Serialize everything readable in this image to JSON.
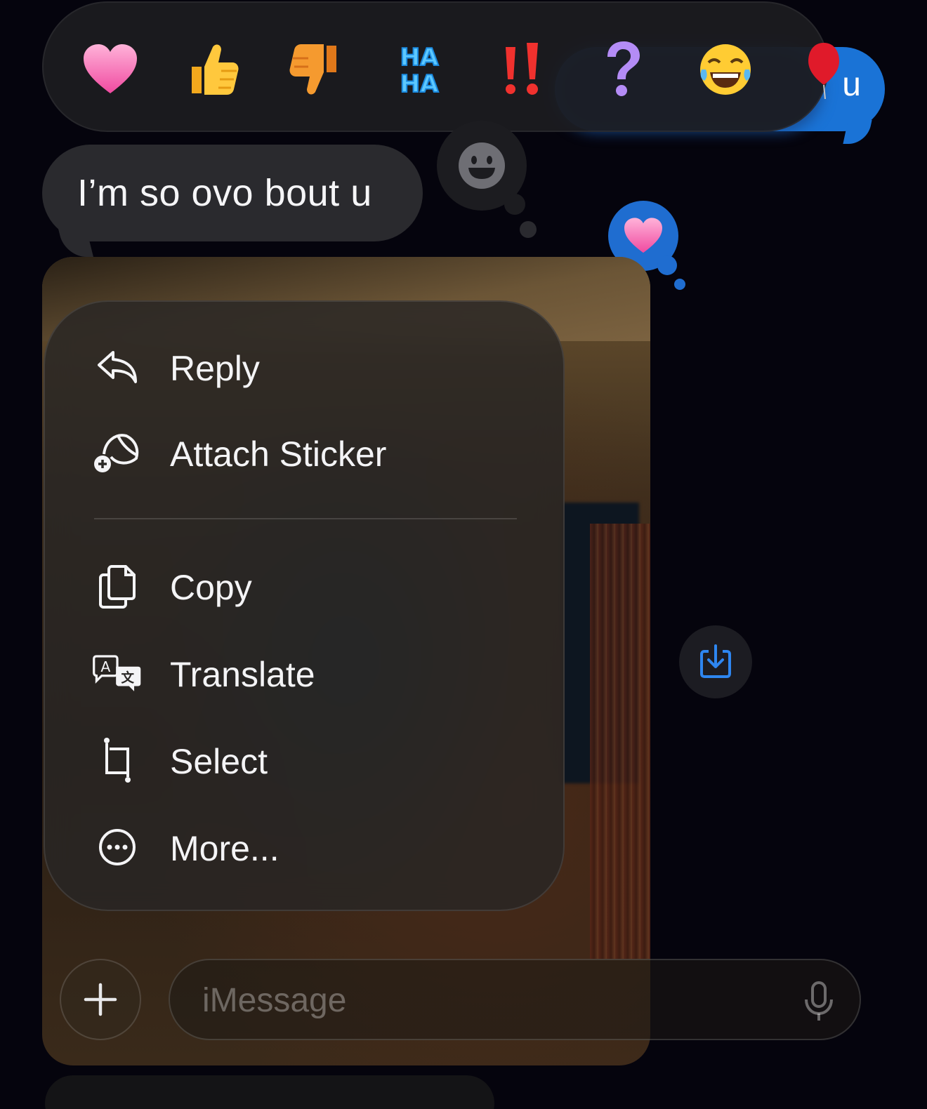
{
  "conversation": {
    "outgoing_bubble": {
      "visible_text": "u"
    },
    "incoming_bubble": {
      "text": "I’m so ovo bout u"
    }
  },
  "tapbacks": [
    {
      "icon": "heart-icon"
    },
    {
      "icon": "thumbs-up-icon"
    },
    {
      "icon": "thumbs-down-icon"
    },
    {
      "icon": "haha-icon",
      "text": "HA HA"
    },
    {
      "icon": "double-exclamation-icon",
      "text": "!!"
    },
    {
      "icon": "question-mark-icon",
      "text": "?"
    },
    {
      "icon": "laughing-emoji-icon"
    },
    {
      "icon": "red-balloon-icon"
    }
  ],
  "context_menu": {
    "items": [
      {
        "icon": "reply-icon",
        "label": "Reply"
      },
      {
        "icon": "sticker-add-icon",
        "label": "Attach Sticker"
      },
      {
        "icon": "copy-icon",
        "label": "Copy"
      },
      {
        "icon": "translate-icon",
        "label": "Translate"
      },
      {
        "icon": "select-crop-icon",
        "label": "Select"
      },
      {
        "icon": "more-ellipsis-icon",
        "label": "More..."
      }
    ]
  },
  "compose": {
    "placeholder": "iMessage",
    "add_icon": "plus-icon",
    "mic_icon": "microphone-icon"
  },
  "colors": {
    "accent_blue": "#1a73d6",
    "background": "#05040d",
    "bubble_gray": "#2a2a2e"
  }
}
